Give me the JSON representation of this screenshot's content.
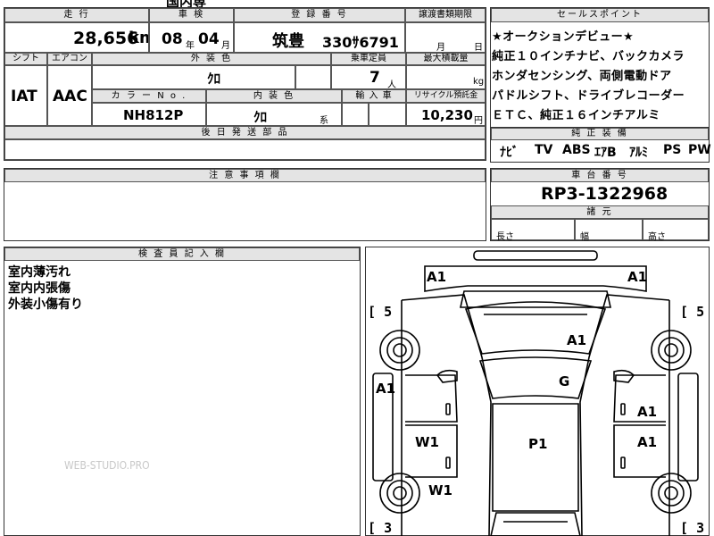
{
  "top_fragment": "国内専",
  "headers": {
    "mileage": "走 行",
    "inspection": "車 検",
    "registration": "登 録 番 号",
    "transfer_deadline": "譲渡書類期限",
    "sales_points": "セールスポイント",
    "shift": "シフト",
    "aircon": "エアコン",
    "exterior_color": "外 装 色",
    "capacity": "乗車定員",
    "max_load": "最大積載量",
    "color_no": "カ ラ ー N o .",
    "interior_color": "内 装 色",
    "import": "輸 入 車",
    "recycle": "リサイクル預託金",
    "delivery_parts": "後 日 発 送 部 品",
    "equipment": "純 正 装 備",
    "caution": "注 意 事 項 欄",
    "chassis": "車 台 番 号",
    "dimensions": "諸 元",
    "inspector": "検 査 員 記 入 欄"
  },
  "vehicle": {
    "mileage_value": "28,656",
    "mileage_unit": "km",
    "inspection_year": "08",
    "year_unit": "年",
    "inspection_month": "04",
    "month_unit": "月",
    "plate_region": "筑豊",
    "plate_number": "330ｻ6791",
    "transfer_month_unit": "月",
    "transfer_day_unit": "日",
    "shift": "IAT",
    "aircon": "AAC",
    "exterior_color": "ｸﾛ",
    "capacity_value": "7",
    "capacity_unit": "人",
    "load_unit": "kg",
    "color_no": "NH812P",
    "interior_color": "ｸﾛ",
    "interior_suffix": "系",
    "recycle_value": "10,230",
    "recycle_unit": "円",
    "chassis_no": "RP3-1322968"
  },
  "sales_points": [
    "★オークションデビュー★",
    "純正１０インチナビ、バックカメラ",
    "ホンダセンシング、両側電動ドア",
    "パドルシフト、ドライブレコーダー",
    "ＥＴＣ、純正１６インチアルミ"
  ],
  "equipment": [
    "ﾅﾋﾞ",
    "TV",
    "ABS",
    "ｴｱB",
    "ｱﾙﾐ",
    "PS",
    "PW"
  ],
  "dimensions": {
    "length": "長さ",
    "width": "幅",
    "height": "高さ"
  },
  "inspector_notes": [
    "室内薄汚れ",
    "室内内張傷",
    "外装小傷有り"
  ],
  "watermark": "WEB-STUDIO.PRO",
  "damage_markers": {
    "front_left": "A1",
    "front_right": "A1",
    "hood": "A1",
    "windshield": "G",
    "left_front_door": "A1",
    "right_front_door": "A1",
    "left_rear_door": "W1",
    "roof": "P1",
    "right_rear_door": "A1",
    "left_rear": "W1"
  },
  "tire_tread": {
    "front_left": "5",
    "front_right": "5",
    "rear_left": "3",
    "rear_right": "3"
  }
}
